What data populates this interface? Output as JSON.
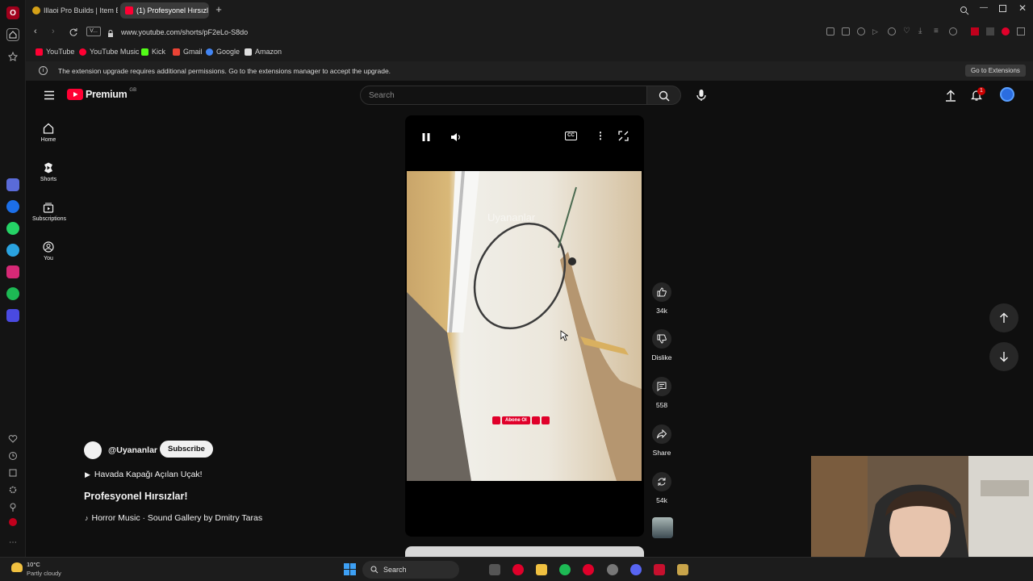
{
  "browser": {
    "tabs": [
      {
        "title": "Illaoi Pro Builds | Item Buil",
        "active": false
      },
      {
        "title": "(1) Profesyonel Hırsızl",
        "active": true
      }
    ],
    "url": "www.youtube.com/shorts/pF2eLo-S8do",
    "site_info": "V...",
    "bookmarks": [
      "YouTube",
      "YouTube Music",
      "Kick",
      "Gmail",
      "Google",
      "Amazon"
    ],
    "infobar": {
      "message": "The extension upgrade requires additional permissions. Go to the extensions manager to accept the upgrade.",
      "button": "Go to Extensions"
    }
  },
  "youtube": {
    "logo": "Premium",
    "country_code": "GB",
    "search_placeholder": "Search",
    "notification_count": "1",
    "nav": [
      "Home",
      "Shorts",
      "Subscriptions",
      "You"
    ],
    "short": {
      "watermark": "Uyananlar",
      "overlay_badge": "Abone Ol",
      "channel": "@Uyananlar",
      "subscribe": "Subscribe",
      "playlist": "Havada Kapağı Açılan Uçak!",
      "title": "Profesyonel Hırsızlar!",
      "music": "Horror Music · Sound Gallery by Dmitry Taras"
    },
    "actions": {
      "like_count": "34k",
      "dislike_label": "Dislike",
      "comment_count": "558",
      "share_label": "Share",
      "remix_count": "54k"
    }
  },
  "taskbar": {
    "weather_temp": "10°C",
    "weather_desc": "Partly cloudy",
    "search_label": "Search"
  },
  "colors": {
    "youtube_red": "#ff0033",
    "background": "#0f0f0f",
    "subscribe_bg": "#f1f1f1"
  }
}
